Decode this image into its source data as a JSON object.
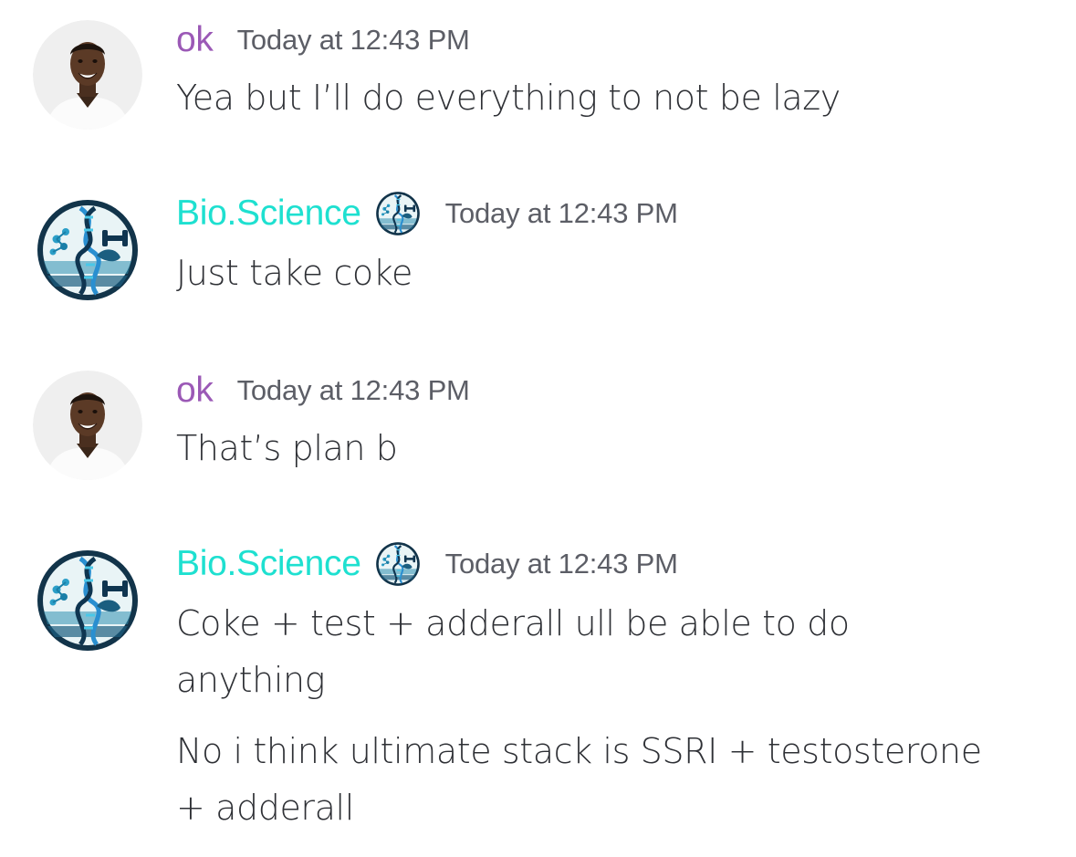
{
  "colors": {
    "user_ok": "#9b59b6",
    "user_bio": "#1ee0d0",
    "timestamp": "#5c5e66",
    "text": "#2e3035"
  },
  "messages": [
    {
      "author": "ok",
      "avatar_icon": "man-smiling-avatar",
      "timestamp": "Today at 12:43 PM",
      "lines": [
        "Yea but I’ll do everything to not be lazy"
      ]
    },
    {
      "author": "Bio.Science",
      "avatar_icon": "dna-dumbbell-logo-avatar",
      "badge_icon": "dna-dumbbell-badge-icon",
      "timestamp": "Today at 12:43 PM",
      "lines": [
        "Just take coke"
      ]
    },
    {
      "author": "ok",
      "avatar_icon": "man-smiling-avatar",
      "timestamp": "Today at 12:43 PM",
      "lines": [
        "That’s plan b"
      ]
    },
    {
      "author": "Bio.Science",
      "avatar_icon": "dna-dumbbell-logo-avatar",
      "badge_icon": "dna-dumbbell-badge-icon",
      "timestamp": "Today at 12:43 PM",
      "lines": [
        "Coke + test + adderall ull be able to do",
        "anything",
        "No i think ultimate stack is SSRI + testosterone",
        "+ adderall"
      ]
    }
  ]
}
